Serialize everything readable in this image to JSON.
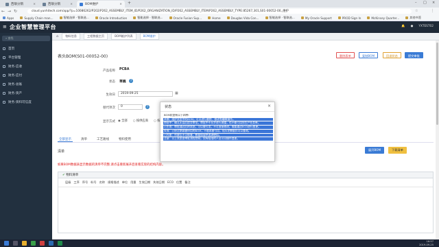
{
  "browser": {
    "tabs": [
      {
        "label": "西联分销"
      },
      {
        "label": "西联分销"
      },
      {
        "label": "BOM维护"
      }
    ],
    "url": "cloud.yunhitech.com/app/?p=10086262/P202/P262_ASSEMBLY_ITEM_ID/P262_ORGANIZATION_ID/P262_ASSEMBLY_ITEM/P262_ASSEMBLY_TYPE:85267,301,S01-00052-00,,维护",
    "bookmarks": [
      "Apps",
      "Supply Chain man...",
      "智能选择 · 智联选...",
      "Oracle Introduction",
      "智能选择 · 智联选...",
      "Oracle Fusion Sup...",
      "Home",
      "Douglas Vida Con...",
      "智能选择 · 智联选...",
      "My Oracle Support",
      "PROD Sign In",
      "McKinsey Quarter...",
      "其他书签"
    ]
  },
  "app": {
    "brand": "企业智慧管理平台",
    "user": "YXTEST02"
  },
  "sidebar": {
    "search_placeholder": "查找",
    "items": [
      {
        "label": "首页"
      },
      {
        "label": "平台管理"
      },
      {
        "label": "财务-应收"
      },
      {
        "label": "财务-应付"
      },
      {
        "label": "财务-总账"
      },
      {
        "label": "财务-资产"
      },
      {
        "label": "财务-资料可信度"
      }
    ]
  },
  "breadcrumbs": [
    "物料信息",
    "工程数据主页",
    "BOM维护列表",
    "BOM维护"
  ],
  "form": {
    "title": "表头BOM(S01-00052-00)",
    "buttons": {
      "delete": "删除表单",
      "copy": "复制BOM",
      "revert": "回退状态",
      "submit": "提交审批"
    },
    "fields": [
      {
        "label": "产品名称",
        "value": "PCBA"
      },
      {
        "label": "状态",
        "value": "草稿"
      },
      {
        "label": "生效日",
        "value": "2019-09-25"
      },
      {
        "label": "替代项次",
        "value": "0"
      },
      {
        "label": "显示方式",
        "options": [
          "全部",
          "按供应商",
          "按采购"
        ]
      }
    ]
  },
  "tabs": [
    "全部显示",
    "清单",
    "工艺路线",
    "物料使用"
  ],
  "list": {
    "label": "清单",
    "warning": "如果BOM数据表显示数据的清单不完整,请点击重新展开后查看实际的结构内容。",
    "expand_btn": "展开BOM",
    "download_btn": "下载清单",
    "section_title": "物料清单",
    "columns": [
      "层级",
      "工序",
      "序号",
      "料号",
      "名称",
      "规格描述",
      "单位",
      "用量",
      "生效日期",
      "失效日期",
      "ECO",
      "位置",
      "备注"
    ]
  },
  "dialog": {
    "title": "状态",
    "lines": [
      {
        "text": "BOM状态有以下四种:",
        "sel": false
      },
      {
        "text": "草稿：维护状态中的BOM，可以进行删除、修改等编辑操作。",
        "sel": true
      },
      {
        "text": "审核中：确认无误后提交审批，审批中不允许进行调整，也不能引用到生产任务单。",
        "sel": true
      },
      {
        "text": "已生效：审批通过后的状态，可以被引用，不可直接修改，需要通过ECO进行变更。",
        "sel": true
      },
      {
        "text": "失效：已经过期或被停用的BOM，不能再被引用，但历史数据仍可以查询。",
        "sel": true
      },
      {
        "text": "已作废：作废后不可恢复，数据保留供追溯使用。",
        "sel": true
      },
      {
        "text": "注意：以上状态由审批流程控制，仅有权限的人员可以操作变更。",
        "sel": true
      }
    ]
  },
  "taskbar": {
    "time": "16:57",
    "date": "2019-09-25"
  },
  "colors": {
    "header_bg": "#1f2a38",
    "sidebar_bg": "#22303f",
    "primary": "#3a7bd5",
    "warning": "#e02020",
    "selection": "#3b76d8"
  }
}
